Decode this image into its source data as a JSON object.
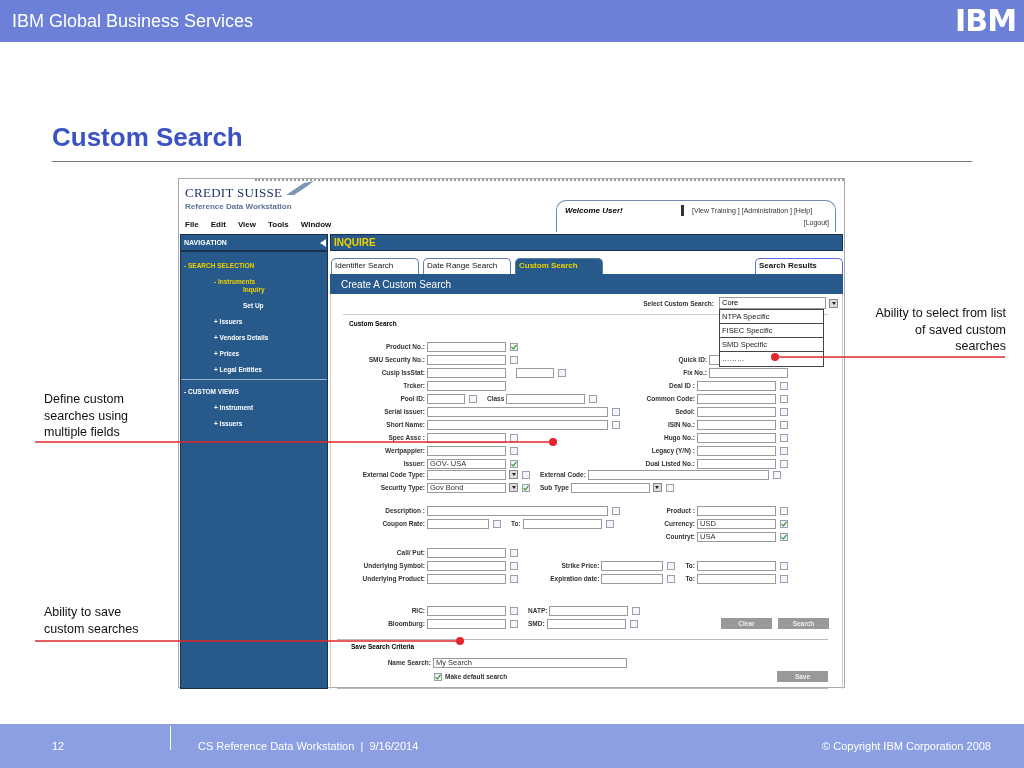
{
  "header": {
    "title": "IBM Global Business Services",
    "logo": "IBM"
  },
  "slide_title": "Custom Search",
  "app": {
    "brand": "CREDIT SUISSE",
    "product": "Reference Data Workstation",
    "menu": [
      "File",
      "Edit",
      "View",
      "Tools",
      "Window"
    ],
    "welcome": "Welcome User!",
    "links": [
      "[View Training ]",
      "[Administration ]",
      "[Help]"
    ],
    "logout": "[Logout]",
    "navigation": {
      "title": "NAVIGATION",
      "sections": [
        {
          "label": "- SEARCH SELECTION",
          "selected": true,
          "children": [
            {
              "label": "- Instruments",
              "selected": true,
              "children": [
                {
                  "label": "Inquiry",
                  "selected": true
                },
                {
                  "label": "Set Up",
                  "selected": false
                }
              ]
            },
            {
              "label": "+ Issuers",
              "selected": false
            },
            {
              "label": "+ Vendors Details",
              "selected": false
            },
            {
              "label": "+ Prices",
              "selected": false
            },
            {
              "label": "+ Legal Entities",
              "selected": false
            }
          ]
        },
        {
          "label": "- CUSTOM VIEWS",
          "selected": false,
          "children": [
            {
              "label": "+ Instrument",
              "selected": false
            },
            {
              "label": "+ Issuers",
              "selected": false
            }
          ]
        }
      ]
    },
    "page_title": "INQUIRE",
    "tabs": [
      {
        "label": "Identifier Search",
        "selected": false,
        "kind": "search"
      },
      {
        "label": "Date Range Search",
        "selected": false,
        "kind": "search"
      },
      {
        "label": "Custom Search",
        "selected": true,
        "kind": "search"
      },
      {
        "label": "Search Results",
        "selected": false,
        "kind": "results"
      }
    ],
    "panel_title": "Create A Custom Search",
    "custom_search": {
      "label": "Select Custom Search:",
      "value": "Core",
      "options": [
        {
          "label": "NTPA Specific",
          "selected": false
        },
        {
          "label": "FISEC Specific",
          "selected": false
        },
        {
          "label": "SMD Specific",
          "selected": false
        },
        {
          "label": "………",
          "selected": false
        }
      ]
    },
    "form_heading": "Custom Search",
    "blocks": [
      {
        "columns": [
          [
            [
              {
                "label": "Product No.:",
                "kind": "medium",
                "checked": true
              }
            ],
            [
              {
                "label": "SMU Security No.:",
                "kind": "medium",
                "checked": false
              }
            ],
            [
              {
                "label": "Cusip IssStat:",
                "kind": "medium"
              },
              {
                "kind": "short",
                "checked": false
              }
            ],
            [
              {
                "label": "Trcker:",
                "kind": "medium"
              }
            ],
            [
              {
                "label": "Pool ID:",
                "kind": "short",
                "checked": false
              },
              {
                "label": "Class",
                "kind": "medium",
                "checked": false
              }
            ],
            [
              {
                "label": "Serial Issuer:",
                "kind": "long",
                "checked": false
              }
            ],
            [
              {
                "label": "Short Name:",
                "kind": "long",
                "checked": false
              }
            ],
            [
              {
                "label": "Spec Assc :",
                "kind": "medium",
                "checked": false
              }
            ],
            [
              {
                "label": "Wertpappier:",
                "kind": "medium",
                "checked": false
              }
            ],
            [
              {
                "label": "Issuer:",
                "value": "GOV- USA",
                "kind": "medium",
                "checked": true
              }
            ]
          ],
          [
            [
              {
                "label": "Quick ID:",
                "kind": "medium"
              }
            ],
            [
              {
                "label": "Fix No.:",
                "kind": "medium"
              }
            ],
            [
              {
                "label": "Deal ID :",
                "kind": "medium",
                "checked": false
              }
            ],
            [
              {
                "label": "Common Code:",
                "kind": "medium",
                "checked": false
              }
            ],
            [
              {
                "label": "Sedol:",
                "kind": "medium",
                "checked": false
              }
            ],
            [
              {
                "label": "ISIN No.:",
                "kind": "medium",
                "checked": false
              }
            ],
            [
              {
                "label": "Hugo No.:",
                "kind": "medium",
                "checked": false
              }
            ],
            [
              {
                "label": "Legacy (Y/N) :",
                "kind": "medium",
                "checked": false
              }
            ],
            [
              {
                "label": "Dual Listed No.:",
                "kind": "medium",
                "checked": false
              }
            ]
          ]
        ]
      },
      {
        "columns": [
          [
            [
              {
                "label": "External Code Type:",
                "kind": "medium",
                "dropdown": true,
                "checked": false
              },
              {
                "label": "External Code:",
                "kind": "long",
                "checked": false
              }
            ],
            [
              {
                "label": "Security Type:",
                "value": "Gov Bond",
                "kind": "medium",
                "dropdown": true,
                "checked": true
              },
              {
                "label": "Sub Type",
                "kind": "medium",
                "dropdown": true,
                "checked": false
              }
            ]
          ]
        ]
      },
      {
        "columns": [
          [
            [
              {
                "label": "Description :",
                "kind": "long",
                "checked": false
              }
            ],
            [
              {
                "label": "Coupon Rate:",
                "kind": "small",
                "checked": false
              },
              {
                "label": "To:",
                "kind": "medium",
                "checked": false
              }
            ]
          ],
          [
            [
              {
                "label": "Product :",
                "kind": "medium",
                "checked": false
              }
            ],
            [
              {
                "label": "Currency:",
                "value": "USD",
                "kind": "medium",
                "checked": true
              }
            ],
            [
              {
                "label": "Countryt:",
                "value": "USA",
                "kind": "medium",
                "checked": true
              }
            ]
          ]
        ]
      },
      {
        "columns": [
          [
            [
              {
                "label": "Call/ Put:",
                "kind": "medium",
                "checked": false
              }
            ],
            [
              {
                "label": "Underlying Symbol:",
                "kind": "medium",
                "checked": false
              }
            ],
            [
              {
                "label": "Underlying Product:",
                "kind": "medium",
                "checked": false
              }
            ]
          ],
          [
            [
              {
                "label": "Strike Price:",
                "kind": "small",
                "checked": false
              },
              {
                "label": "To:",
                "kind": "medium",
                "checked": false
              }
            ],
            [
              {
                "label": "Expiration date:",
                "kind": "small",
                "checked": false
              },
              {
                "label": "To:",
                "kind": "medium",
                "checked": false
              }
            ]
          ]
        ]
      },
      {
        "columns": [
          [
            [
              {
                "label": "RIC:",
                "kind": "medium",
                "checked": false
              },
              {
                "label": "NATP:",
                "kind": "medium",
                "checked": false
              }
            ],
            [
              {
                "label": "Bloomburg:",
                "kind": "medium",
                "checked": false
              },
              {
                "label": "SMD:",
                "kind": "medium",
                "checked": false
              }
            ]
          ],
          [
            [
              {
                "kind": "button",
                "label": "Clear"
              },
              {
                "kind": "button",
                "label": "Search"
              }
            ]
          ]
        ]
      }
    ],
    "save": {
      "heading": "Save Search Criteria",
      "label": "Name Search:",
      "value": "My Search",
      "default_label": "Make default search",
      "default_checked": true,
      "button": "Save"
    }
  },
  "annotations": [
    "Ability to select from list of saved custom searches",
    "Define custom searches using multiple fields",
    "Ability to save custom searches"
  ],
  "footer": {
    "page": "12",
    "title": "CS Reference Data Workstation  |  9/16/2014",
    "copyright": "© Copyright IBM Corporation 2008"
  }
}
